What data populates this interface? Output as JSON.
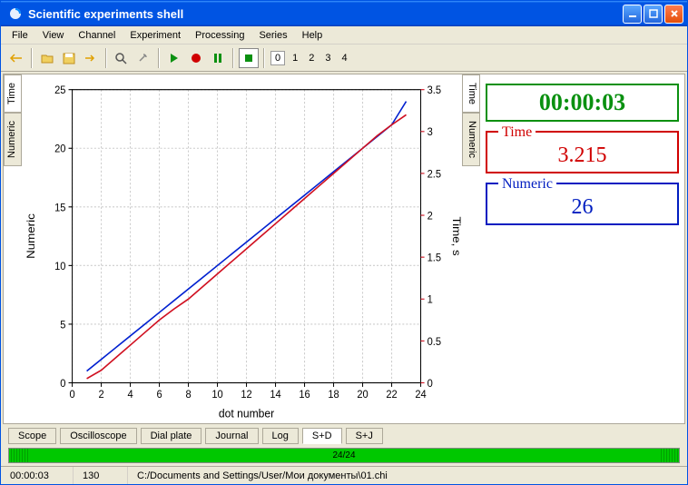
{
  "titlebar": {
    "title": "Scientific experiments shell"
  },
  "menu": {
    "items": [
      "File",
      "View",
      "Channel",
      "Experiment",
      "Processing",
      "Series",
      "Help"
    ]
  },
  "toolbar": {
    "numbers": [
      "0",
      "1",
      "2",
      "3",
      "4"
    ]
  },
  "left_tabs": {
    "top": "Time",
    "bottom": "Numeric"
  },
  "right_tabs": {
    "top": "Time",
    "bottom": "Numeric"
  },
  "displays": {
    "clock": {
      "value": "00:00:03"
    },
    "time": {
      "label": "Time",
      "value": "3.215"
    },
    "numeric": {
      "label": "Numeric",
      "value": "26"
    }
  },
  "bottom_tabs": {
    "items": [
      "Scope",
      "Oscilloscope",
      "Dial plate",
      "Journal",
      "Log",
      "S+D",
      "S+J"
    ],
    "active": "S+D"
  },
  "progress": {
    "text": "24/24"
  },
  "status": {
    "time": "00:00:03",
    "count": "130",
    "path": "C:/Documents and Settings/User/Мои документы\\01.chi"
  },
  "chart_data": {
    "type": "line",
    "xlabel": "dot number",
    "y_left_label": "Numeric",
    "y_right_label": "Time, s",
    "x_range": [
      0,
      24
    ],
    "y_left_range": [
      0,
      25
    ],
    "y_right_range": [
      0,
      3.5
    ],
    "x_ticks": [
      0,
      2,
      4,
      6,
      8,
      10,
      12,
      14,
      16,
      18,
      20,
      22,
      24
    ],
    "y_left_ticks": [
      0,
      5,
      10,
      15,
      20,
      25
    ],
    "y_right_ticks": [
      0,
      0.5,
      1,
      1.5,
      2,
      2.5,
      3,
      3.5
    ],
    "series": [
      {
        "name": "Numeric",
        "axis": "left",
        "color": "#0020d0",
        "x": [
          1,
          2,
          3,
          4,
          5,
          6,
          7,
          8,
          9,
          10,
          11,
          12,
          13,
          14,
          15,
          16,
          17,
          18,
          19,
          20,
          21,
          22,
          23
        ],
        "y": [
          1,
          2,
          3,
          4,
          5,
          6,
          7,
          8,
          9,
          10,
          11,
          12,
          13,
          14,
          15,
          16,
          17,
          18,
          19,
          20,
          21,
          22,
          24
        ]
      },
      {
        "name": "Time",
        "axis": "right",
        "color": "#d01020",
        "x": [
          1,
          2,
          3,
          4,
          5,
          6,
          7,
          8,
          9,
          10,
          11,
          12,
          13,
          14,
          15,
          16,
          17,
          18,
          19,
          20,
          21,
          22,
          23
        ],
        "y": [
          0.05,
          0.15,
          0.3,
          0.45,
          0.6,
          0.75,
          0.88,
          1.0,
          1.15,
          1.3,
          1.45,
          1.6,
          1.75,
          1.9,
          2.05,
          2.2,
          2.35,
          2.5,
          2.65,
          2.8,
          2.95,
          3.08,
          3.2
        ]
      }
    ]
  }
}
